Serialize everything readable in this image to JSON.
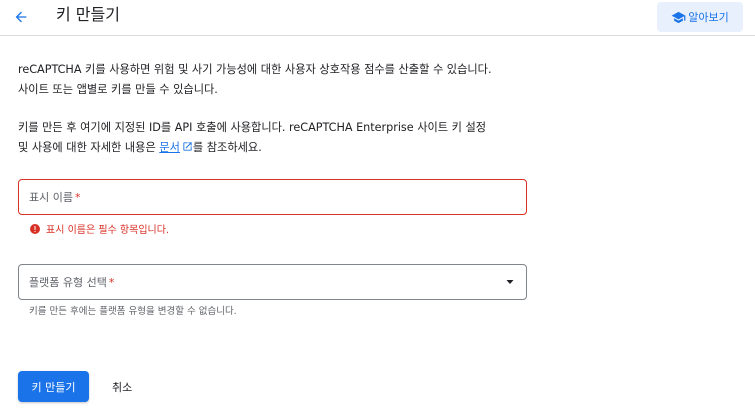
{
  "header": {
    "title": "키 만들기",
    "back_icon": "arrow-left-icon",
    "learn_button": {
      "label": "알아보기",
      "icon": "school-icon"
    }
  },
  "intro": {
    "line1": "reCAPTCHA 키를 사용하면 위험 및 사기 가능성에 대한 사용자 상호작용 점수를 산출할 수 있습니다.",
    "line2": "사이트 또는 앱별로 키를 만들 수 있습니다."
  },
  "info": {
    "line1": "키를 만든 후 여기에 지정된 ID를 API 호출에 사용합니다. reCAPTCHA Enterprise 사이트 키 설정",
    "line2_before": "및 사용에 대한 자세한 내용은 ",
    "link_text": "문서",
    "line2_after": "를 참조하세요."
  },
  "form": {
    "display_name": {
      "label": "표시 이름",
      "required_mark": "*",
      "error": "표시 이름은 필수 항목입니다."
    },
    "platform": {
      "label": "플랫폼 유형 선택",
      "required_mark": "*",
      "helper": "키를 만든 후에는 플랫폼 유형을 변경할 수 없습니다."
    }
  },
  "actions": {
    "create_label": "키 만들기",
    "cancel_label": "취소"
  },
  "colors": {
    "primary": "#1a73e8",
    "error": "#d93025",
    "learn_bg": "#e8f0fe"
  }
}
